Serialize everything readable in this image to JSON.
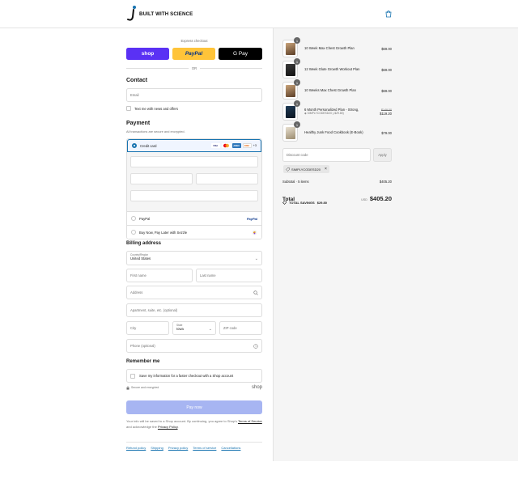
{
  "brand": {
    "name": "BUILT WITH SCIENCE",
    "accent": "#1773b0"
  },
  "header": {
    "cart_icon": "shopping-bag-icon"
  },
  "express": {
    "label": "Express checkout",
    "shop": "shop",
    "paypal": "PayPal",
    "gpay": "G Pay",
    "or": "OR"
  },
  "contact": {
    "title": "Contact",
    "email_placeholder": "Email",
    "news_label": "Text me with news and offers"
  },
  "payment": {
    "title": "Payment",
    "subtitle": "All transactions are secure and encrypted.",
    "credit_card": "Credit card",
    "cards": [
      "VISA",
      "MC",
      "AMEX",
      "DISC"
    ],
    "more_cards": "+3",
    "paypal": "PayPal",
    "paypal_logo": "PayPal",
    "sezzle": "Buy Now, Pay Later with Sezzle"
  },
  "billing": {
    "title": "Billing address",
    "country_label": "Country/Region",
    "country_value": "United States",
    "first_name": "First name",
    "last_name": "Last name",
    "address": "Address",
    "apartment": "Apartment, suite, etc. (optional)",
    "city": "City",
    "state_label": "State",
    "state_value": "Iowa",
    "zip": "ZIP code",
    "phone": "Phone (optional)"
  },
  "remember": {
    "title": "Remember me",
    "save_label": "Save my information for a faster checkout with a Shop account",
    "secure": "Secure and encrypted",
    "shop": "shop"
  },
  "pay_now": "Pay now",
  "legal": {
    "text1": "Your info will be saved to a Shop account. By continuing, you agree to Shop's",
    "terms": "Terms of Service",
    "text2": "and acknowledge the",
    "privacy": "Privacy Policy",
    "end": "."
  },
  "footer": [
    "Refund policy",
    "Shipping",
    "Privacy policy",
    "Terms of service",
    "Cancellations"
  ],
  "cart": {
    "items": [
      {
        "name": "10 Week Max Chest Growth Plan",
        "price": "$69.00",
        "qty": "1"
      },
      {
        "name": "12 Week Glute Growth Workout Plan",
        "price": "$69.00",
        "qty": "1"
      },
      {
        "name": "10 Weeks Max Chest Growth Plan",
        "price": "$69.00",
        "qty": "1"
      },
      {
        "name": "6 Month Personalized Plan - Strong,",
        "discount": "SIMPLYCODESD20 (-$29.80)",
        "old_price": "$149.00",
        "price": "$119.20",
        "qty": "1"
      },
      {
        "name": "Healthy Junk Food Cookbook (E-Book)",
        "price": "$79.00",
        "qty": "1"
      }
    ],
    "discount_placeholder": "Discount code",
    "apply": "Apply",
    "code": "SIMPLYCODESD20",
    "subtotal_label": "Subtotal · 5 items",
    "subtotal": "$405.20",
    "total_label": "Total",
    "currency": "USD",
    "total": "$405.20",
    "savings_label": "TOTAL SAVINGS",
    "savings": "$29.80"
  }
}
